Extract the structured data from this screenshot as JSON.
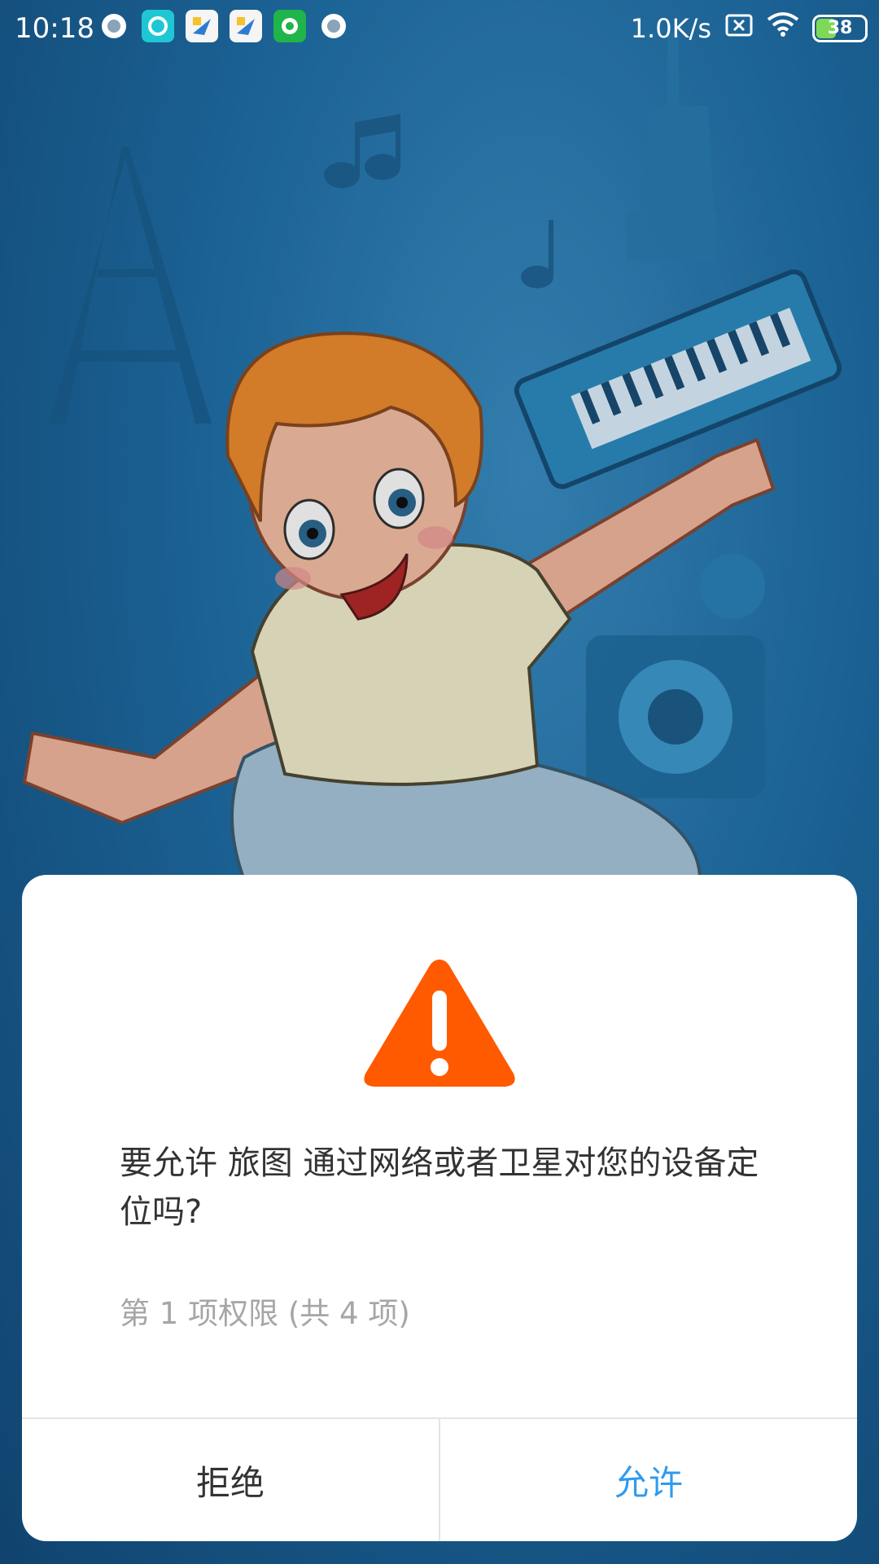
{
  "status_bar": {
    "time": "10:18",
    "network_speed": "1.0K/s",
    "battery_level": "38",
    "notification_icons": [
      "circle-icon",
      "app-icon",
      "travel-icon",
      "travel-icon",
      "wechat-icon",
      "circle-icon"
    ]
  },
  "dialog": {
    "icon": "warning-icon",
    "message": "要允许 旅图 通过网络或者卫星对您的设备定位吗?",
    "permission_progress": "第 1 项权限 (共 4 项)",
    "deny_label": "拒绝",
    "allow_label": "允许"
  },
  "colors": {
    "warning": "#ff5a00",
    "allow_button": "#2f9bef",
    "battery_fill": "#7ed957"
  }
}
